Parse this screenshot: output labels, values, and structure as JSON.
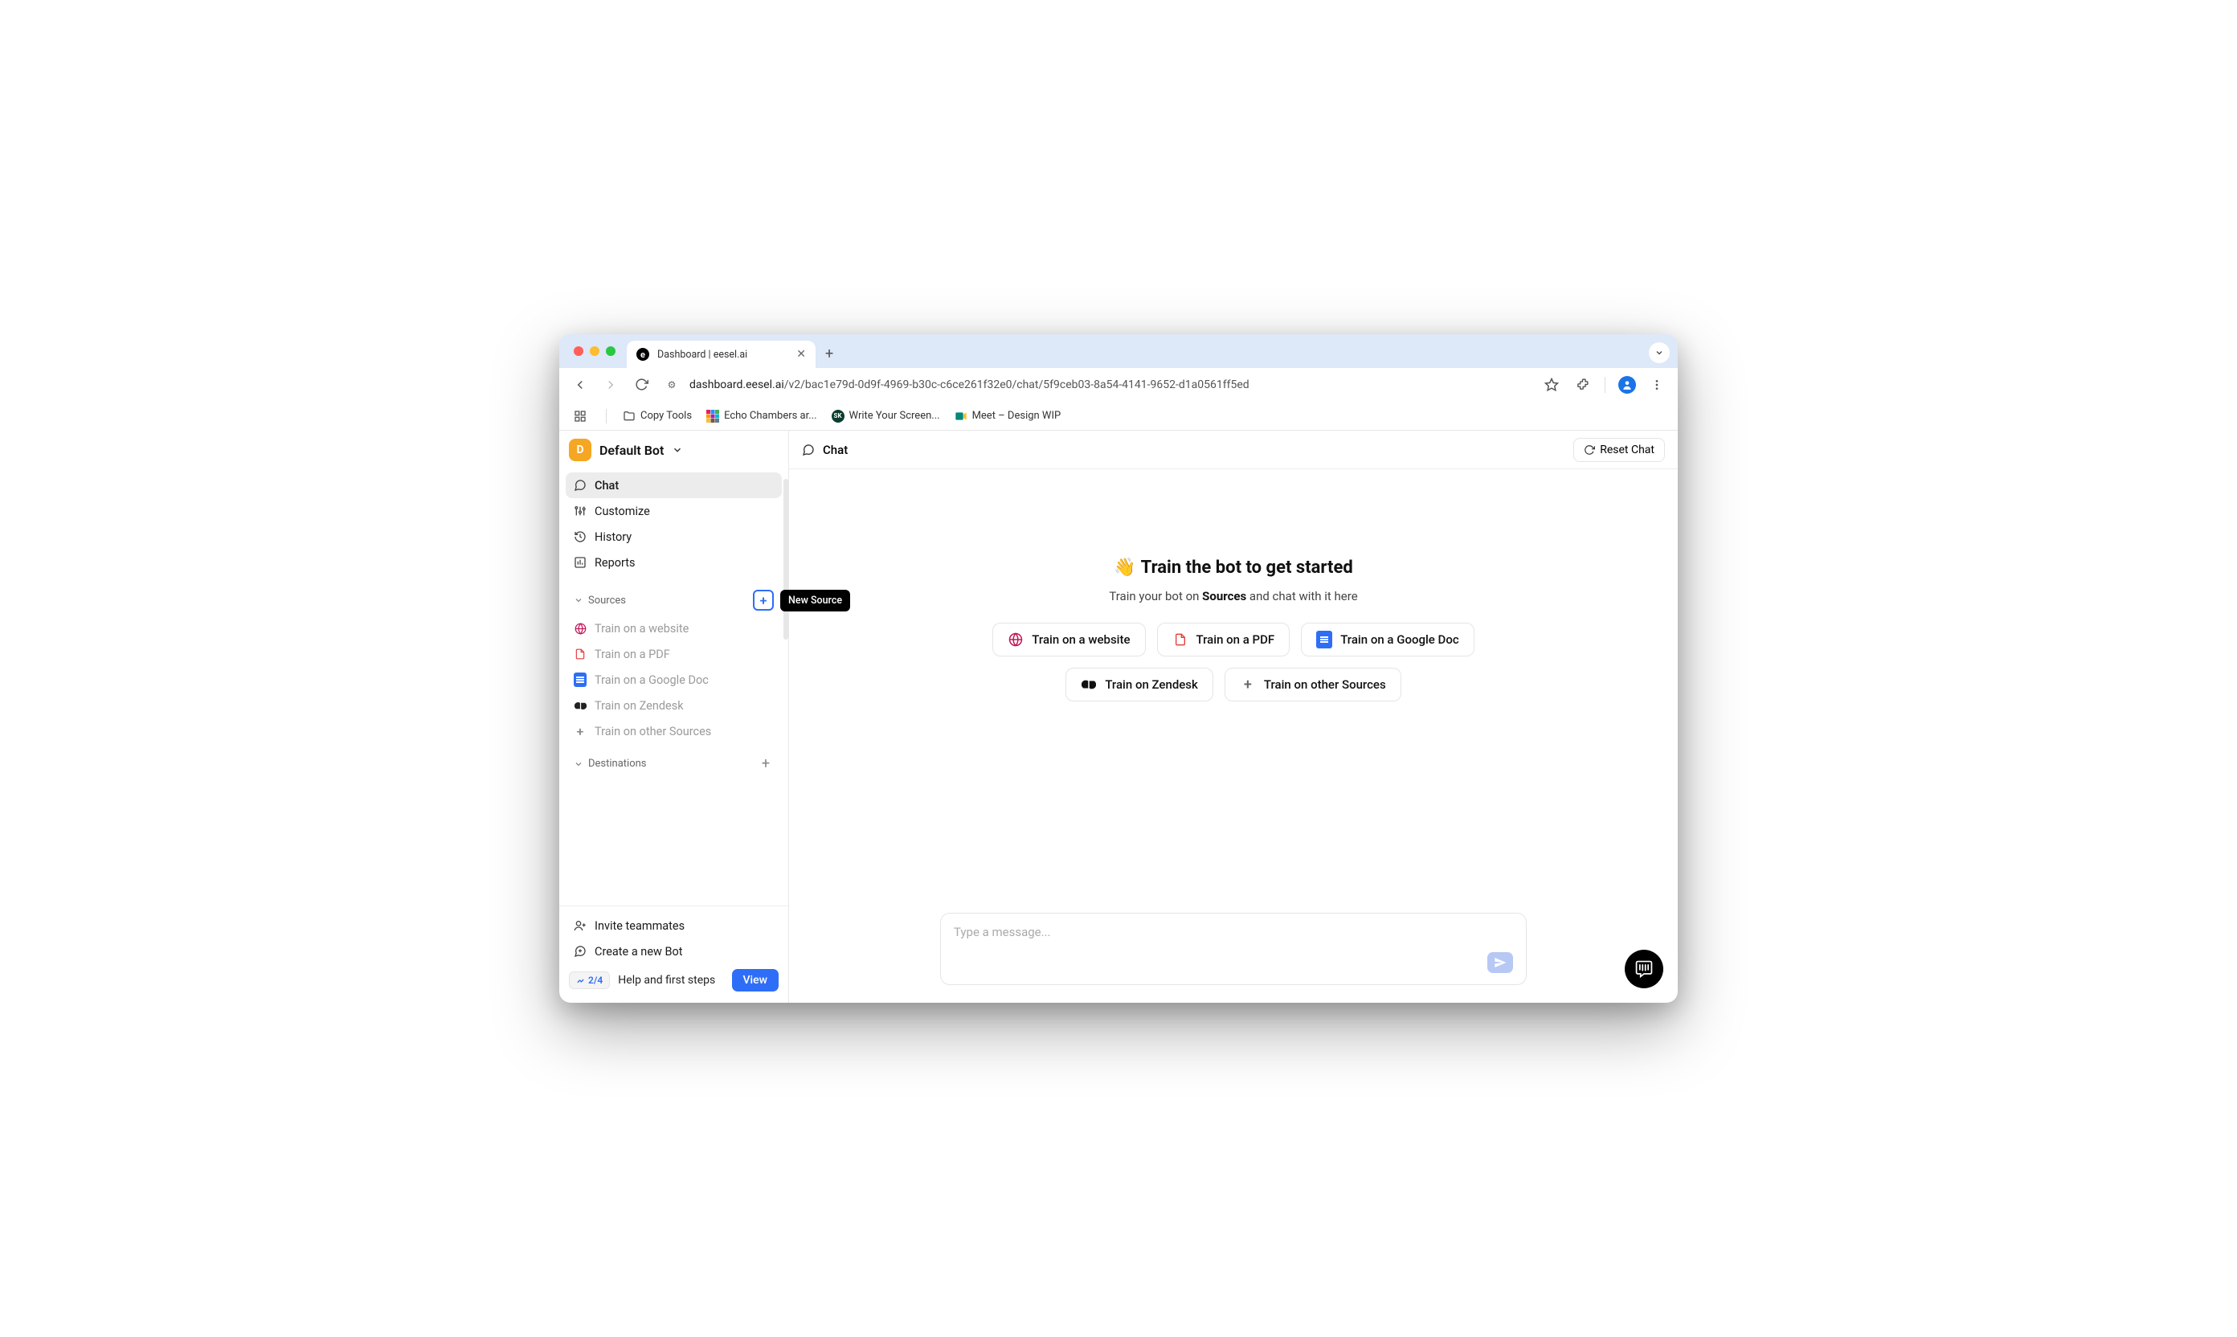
{
  "browser": {
    "tab_title": "Dashboard | eesel.ai",
    "tab_favicon_letter": "e",
    "url_host": "dashboard.eesel.ai",
    "url_path": "/v2/bac1e79d-0d9f-4969-b30c-c6ce261f32e0/chat/5f9ceb03-8a54-4141-9652-d1a0561ff5ed",
    "bookmarks": [
      {
        "label": "Copy Tools",
        "icon": "folder"
      },
      {
        "label": "Echo Chambers ar...",
        "icon": "colorgrid"
      },
      {
        "label": "Write Your Screen...",
        "icon": "dotgreen"
      },
      {
        "label": "Meet – Design WIP",
        "icon": "meet"
      }
    ]
  },
  "sidebar": {
    "bot_initial": "D",
    "bot_name": "Default Bot",
    "nav": [
      {
        "label": "Chat",
        "icon": "chat",
        "active": true
      },
      {
        "label": "Customize",
        "icon": "customize",
        "active": false
      },
      {
        "label": "History",
        "icon": "history",
        "active": false
      },
      {
        "label": "Reports",
        "icon": "reports",
        "active": false
      }
    ],
    "sources_label": "Sources",
    "new_source_tooltip": "New Source",
    "sources": [
      {
        "label": "Train on a website",
        "icon": "globe"
      },
      {
        "label": "Train on a PDF",
        "icon": "pdf"
      },
      {
        "label": "Train on a Google Doc",
        "icon": "gdoc"
      },
      {
        "label": "Train on Zendesk",
        "icon": "zendesk"
      },
      {
        "label": "Train on other Sources",
        "icon": "plus"
      }
    ],
    "destinations_label": "Destinations",
    "footer": {
      "invite": "Invite teammates",
      "create_bot": "Create a new Bot",
      "progress": "2/4",
      "help_label": "Help and first steps",
      "view_label": "View"
    }
  },
  "main": {
    "header_label": "Chat",
    "reset_label": "Reset Chat",
    "hero_emoji": "👋",
    "hero_title": "Train the bot to get started",
    "hero_sub_pre": "Train your bot on ",
    "hero_sub_bold": "Sources",
    "hero_sub_post": " and chat with it here",
    "chips": [
      {
        "label": "Train on a website",
        "icon": "globe"
      },
      {
        "label": "Train on a PDF",
        "icon": "pdf"
      },
      {
        "label": "Train on a Google Doc",
        "icon": "gdoc"
      },
      {
        "label": "Train on Zendesk",
        "icon": "zendesk"
      },
      {
        "label": "Train on other Sources",
        "icon": "plus"
      }
    ],
    "message_placeholder": "Type a message..."
  }
}
